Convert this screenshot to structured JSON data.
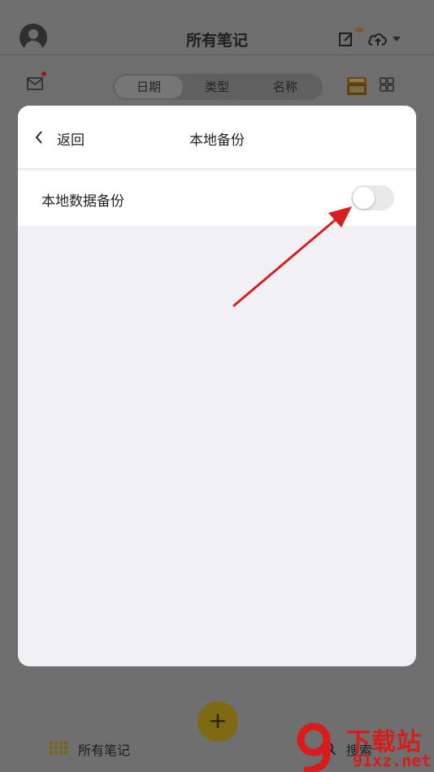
{
  "app": {
    "title": "所有笔记",
    "segments": [
      "日期",
      "类型",
      "名称"
    ],
    "active_segment": "日期"
  },
  "bottom_nav": {
    "notes_label": "所有笔记",
    "search_label": "搜索",
    "fab_label": "+"
  },
  "modal": {
    "back_label": "返回",
    "title": "本地备份",
    "setting_label": "本地数据备份",
    "toggle_state": "off"
  },
  "watermark": {
    "brand": "下载站",
    "url": "91xz.net"
  },
  "colors": {
    "accent": "#f2c40f",
    "annotation_arrow": "#d61f1f",
    "notification_dot": "#c62828"
  }
}
